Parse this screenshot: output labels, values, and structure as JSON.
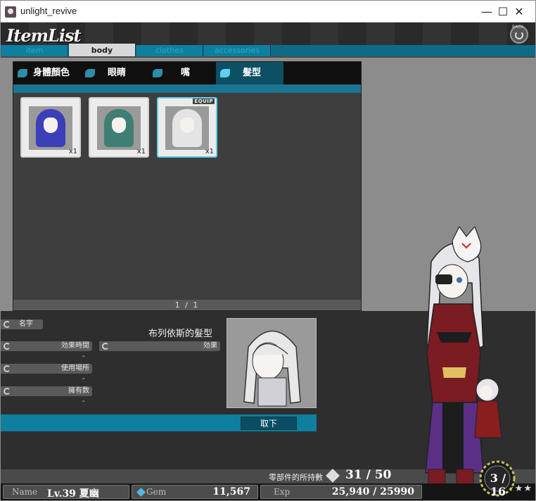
{
  "window": {
    "title": "unlight_revive",
    "minimize": "—",
    "maximize": "☐",
    "close": "✕"
  },
  "header": {
    "logo": "ItemList",
    "back_label": "BACK"
  },
  "tabs": [
    {
      "label": "item",
      "active": false
    },
    {
      "label": "body",
      "active": true
    },
    {
      "label": "clothes",
      "active": false
    },
    {
      "label": "accessories",
      "active": false
    }
  ],
  "subtabs": [
    {
      "label": "身體顏色",
      "active": false
    },
    {
      "label": "眼睛",
      "active": false
    },
    {
      "label": "嘴",
      "active": false
    },
    {
      "label": "髮型",
      "active": true
    }
  ],
  "items": [
    {
      "qty": "x1",
      "hair_color": "#3b3fb8",
      "equipped": false
    },
    {
      "qty": "x1",
      "hair_color": "#3f7f73",
      "equipped": false
    },
    {
      "qty": "x1",
      "hair_color": "#e4e4e4",
      "equipped": true,
      "equip_label": "EQUIP"
    }
  ],
  "pager": "1 / 1",
  "detail": {
    "name_label": "名字",
    "name_value": "布列依斯的髮型",
    "time_label": "効果時間",
    "time_value": "-",
    "effect_label": "効果",
    "place_label": "使用場所",
    "place_value": "-",
    "owned_label": "擁有数",
    "owned_value": "-",
    "remove_button": "取下"
  },
  "parts_count": {
    "label": "零部件的所持數",
    "value": "31 / 50"
  },
  "badge": {
    "value": "3 / 16",
    "stars": "★★★"
  },
  "status": {
    "name_label": "Name",
    "name_value": "Lv.39 夏幽",
    "gem_label": "Gem",
    "gem_value": "11,567",
    "exp_label": "Exp",
    "exp_value": "25,940 / 25990"
  },
  "colors": {
    "accent": "#0e7f9f",
    "accent_dark": "#0d4f63",
    "highlight": "#5fd0ee"
  }
}
